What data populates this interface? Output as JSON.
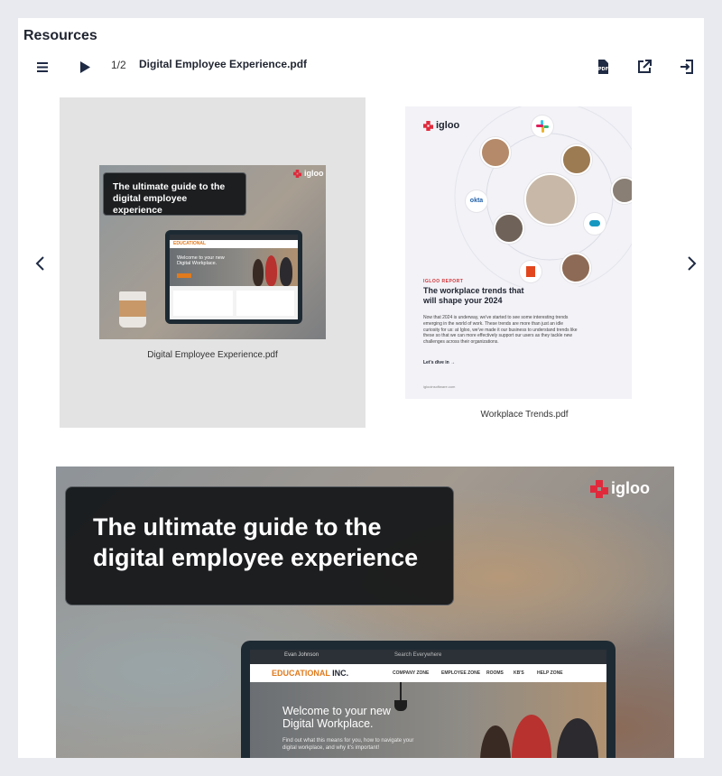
{
  "page": {
    "title": "Resources"
  },
  "toolbar": {
    "page_current": "1/2",
    "file_name": "Digital Employee Experience.pdf",
    "icons": [
      "menu-icon",
      "play-icon",
      "pdf-icon",
      "open-external-icon",
      "export-icon"
    ]
  },
  "thumbnails": [
    {
      "caption": "Digital Employee Experience.pdf",
      "cover": {
        "headline": "The ultimate guide to the digital employee experience",
        "logo": "igloo",
        "screen_brand": "EDUCATIONAL",
        "screen_brand_suffix": " INC.",
        "screen_hero": "Welcome to your new Digital Workplace."
      }
    },
    {
      "caption": "Workplace Trends.pdf",
      "cover": {
        "logo": "igloo",
        "tag": "IGLOO REPORT",
        "title": "The workplace trends that will shape your 2024",
        "body": "Now that 2024 is underway, we've started to see some interesting trends emerging in the world of work. These trends are more than just an idle curiosity for us: at Igloo, we've made it our business to understand trends like these so that we can more effectively support our users as they tackle new challenges across their organizations.",
        "cta": "Let's dive in →",
        "footer": "iglooinsoftware.com",
        "brand_okta": "okta"
      }
    }
  ],
  "preview": {
    "headline": "The ultimate guide to the digital employee experience",
    "logo": "igloo",
    "screen": {
      "user": "Evan Johnson",
      "search_placeholder": "Search Everywhere",
      "brand": "EDUCATIONAL",
      "brand_suffix": " INC.",
      "nav": [
        "COMPANY ZONE",
        "EMPLOYEE ZONE",
        "ROOMS",
        "KB'S",
        "HELP ZONE"
      ],
      "hero_title": "Welcome to your new Digital Workplace.",
      "hero_text": "Find out what this means for you, how to navigate your digital workplace, and why it's important!"
    }
  },
  "colors": {
    "accent": "#e02a3c",
    "brand_orange": "#e07a1d",
    "panel_bg": "#ffffff",
    "page_bg": "#e8eaef"
  }
}
